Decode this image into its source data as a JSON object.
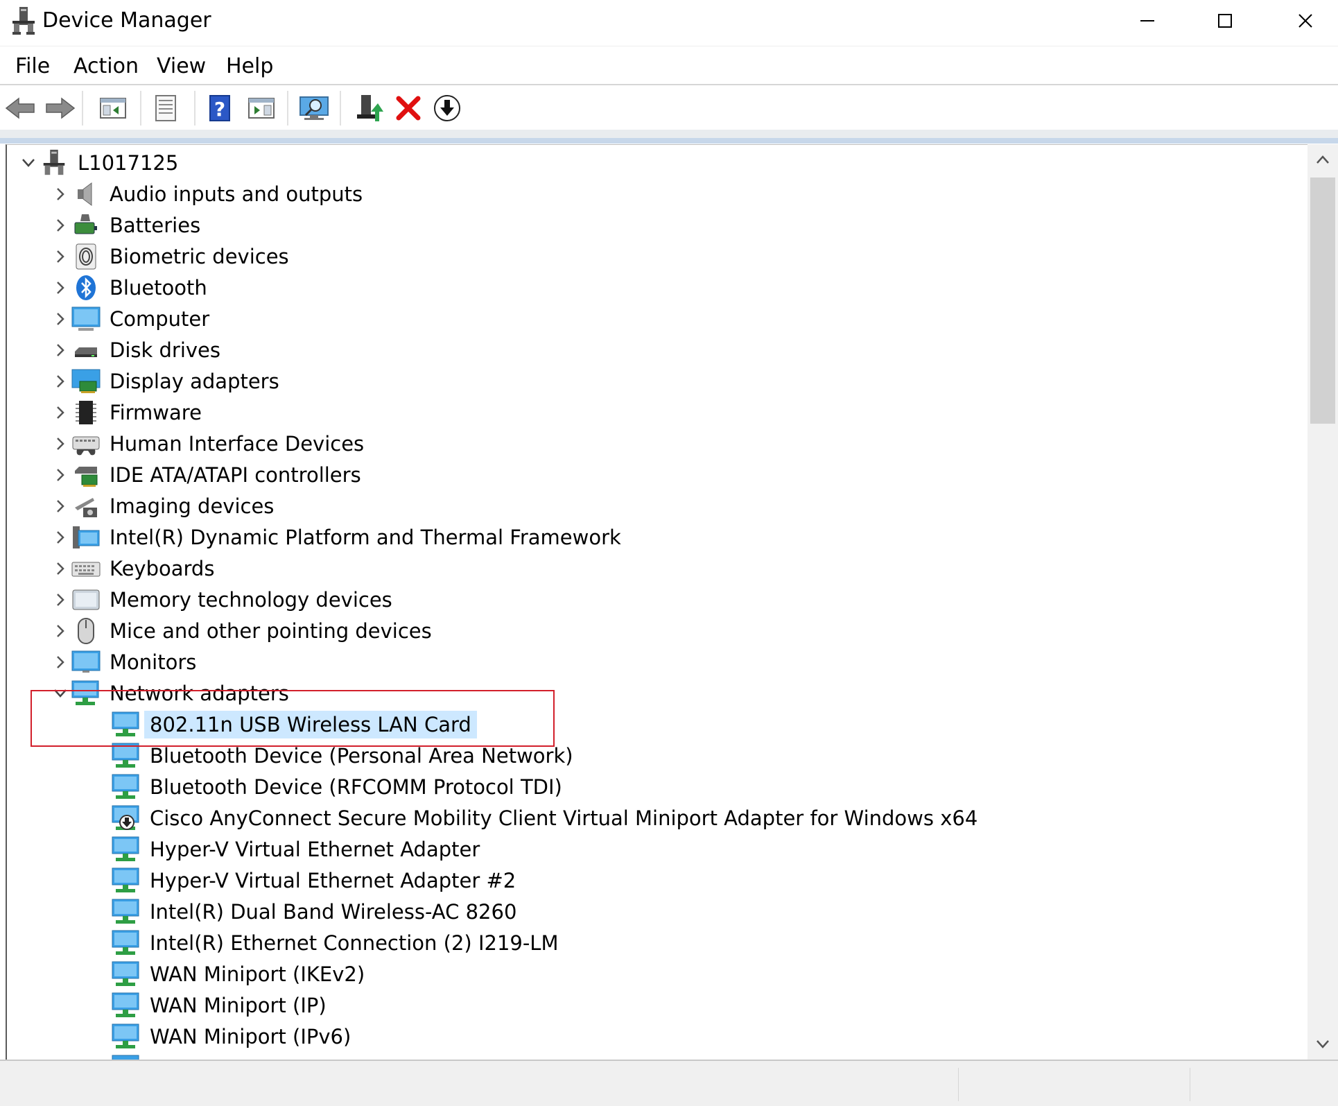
{
  "window": {
    "title": "Device Manager"
  },
  "menu": [
    "File",
    "Action",
    "View",
    "Help"
  ],
  "tree": {
    "root": "L1017125",
    "categories": [
      "Audio inputs and outputs",
      "Batteries",
      "Biometric devices",
      "Bluetooth",
      "Computer",
      "Disk drives",
      "Display adapters",
      "Firmware",
      "Human Interface Devices",
      "IDE ATA/ATAPI controllers",
      "Imaging devices",
      "Intel(R) Dynamic Platform and Thermal Framework",
      "Keyboards",
      "Memory technology devices",
      "Mice and other pointing devices",
      "Monitors",
      "Network adapters"
    ],
    "network_adapters": [
      "802.11n USB Wireless LAN Card",
      "Bluetooth Device (Personal Area Network)",
      "Bluetooth Device (RFCOMM Protocol TDI)",
      "Cisco AnyConnect Secure Mobility Client Virtual Miniport Adapter for Windows x64",
      "Hyper-V Virtual Ethernet Adapter",
      "Hyper-V Virtual Ethernet Adapter #2",
      "Intel(R) Dual Band Wireless-AC 8260",
      "Intel(R) Ethernet Connection (2) I219-LM",
      "WAN Miniport (IKEv2)",
      "WAN Miniport (IP)",
      "WAN Miniport (IPv6)"
    ]
  },
  "colors": {
    "selection": "#cde8ff",
    "highlight_box": "#d21f2b",
    "network_icon": "#1e8fdc"
  }
}
